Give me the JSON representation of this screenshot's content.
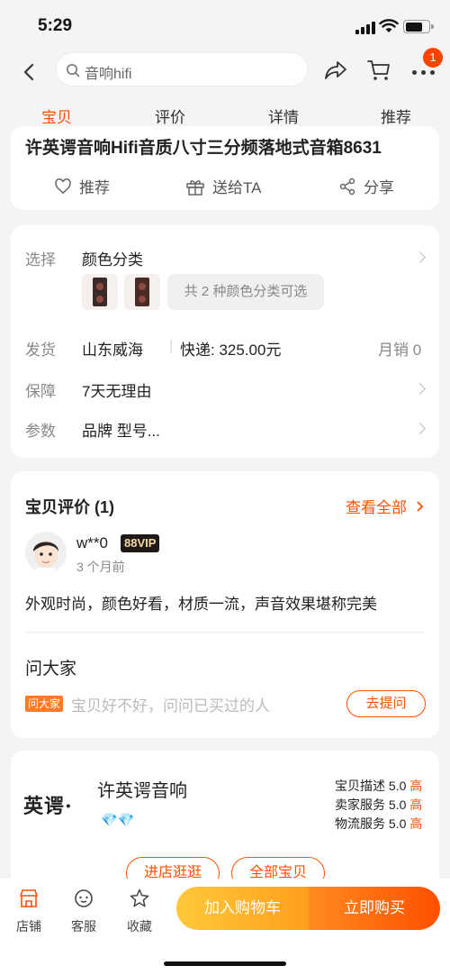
{
  "status": {
    "time": "5:29"
  },
  "header": {
    "search_text": "音响hifi",
    "badge_count": "1"
  },
  "tabs": [
    "宝贝",
    "评价",
    "详情",
    "推荐"
  ],
  "product": {
    "title": "许英谔音响Hifi音质八寸三分频落地式音箱8631",
    "actions": {
      "recommend": "推荐",
      "gift": "送给TA",
      "share": "分享"
    }
  },
  "options": {
    "select": {
      "label": "选择",
      "value": "颜色分类",
      "count_text": "共 2 种颜色分类可选"
    },
    "shipping": {
      "label": "发货",
      "origin": "山东威海",
      "express": "快递: 325.00元",
      "sales": "月销 0"
    },
    "guarantee": {
      "label": "保障",
      "value": "7天无理由"
    },
    "params": {
      "label": "参数",
      "value": "品牌 型号..."
    }
  },
  "reviews": {
    "title": "宝贝评价 (1)",
    "view_all": "查看全部",
    "user": "w**0",
    "vip": "88VIP",
    "time_ago": "3 个月前",
    "text": "外观时尚，颜色好看，材质一流，声音效果堪称完美"
  },
  "qa": {
    "title": "问大家",
    "tag": "问大家",
    "placeholder": "宝贝好不好，问问已买过的人",
    "ask_button": "去提问"
  },
  "shop": {
    "logo_text": "英谔·",
    "name": "许英谔音响",
    "scores": [
      {
        "label": "宝贝描述",
        "score": "5.0",
        "level": "高"
      },
      {
        "label": "卖家服务",
        "score": "5.0",
        "level": "高"
      },
      {
        "label": "物流服务",
        "score": "5.0",
        "level": "高"
      }
    ],
    "enter_button": "进店逛逛",
    "all_button": "全部宝贝"
  },
  "bottom": {
    "store": "店铺",
    "service": "客服",
    "favorite": "收藏",
    "add_cart": "加入购物车",
    "buy_now": "立即购买"
  },
  "colors": {
    "accent": "#ff5000",
    "cart_gradient": "#ffc93a",
    "buy_gradient": "#ff5000"
  }
}
